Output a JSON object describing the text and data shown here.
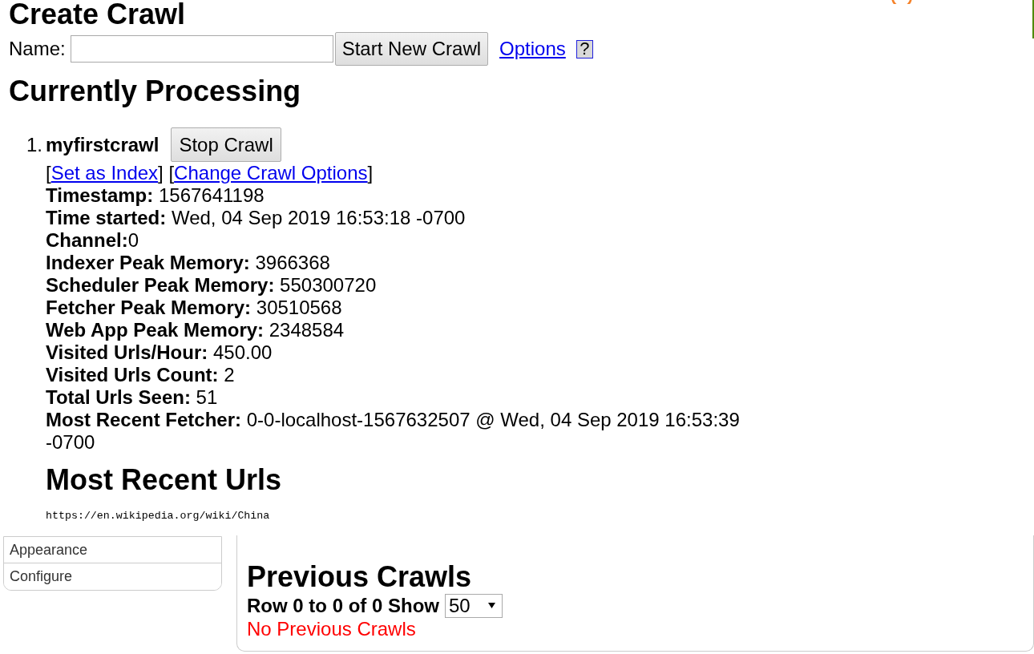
{
  "create_crawl": {
    "heading": "Create Crawl",
    "name_label": "Name:",
    "start_button": "Start New Crawl",
    "options_link": "Options",
    "help_button": "?"
  },
  "currently_processing": {
    "heading": "Currently Processing",
    "crawls": [
      {
        "number": "1.",
        "name": "myfirstcrawl",
        "stop_button": "Stop Crawl",
        "action_links": [
          {
            "before": "[",
            "text": "Set as Index",
            "after": "]"
          },
          {
            "before": "[",
            "text": "Change Crawl Options",
            "after": "]"
          }
        ],
        "stats": [
          "**Timestamp:** 1567641198",
          "**Time started:** Wed, 04 Sep 2019 16:53:18 -0700",
          "**Channel:**0",
          "**Indexer Peak Memory:** 3966368",
          "**Scheduler Peak Memory:** 550300720",
          "**Fetcher Peak Memory:** 30510568",
          "**Web App Peak Memory:** 2348584",
          "**Visited Urls/Hour:** 450.00",
          "**Visited Urls Count:** 2",
          "**Total Urls Seen:** 51",
          "**Most Recent Fetcher:** 0-0-localhost-1567632507 @ Wed, 04 Sep 2019 16:53:39 -0700"
        ],
        "recent_urls_heading": "Most Recent Urls",
        "recent_urls": [
          "https://en.wikipedia.org/wiki/China"
        ]
      }
    ]
  },
  "sidebar": {
    "items": [
      {
        "label": "Appearance",
        "selected": false
      },
      {
        "label": "Configure",
        "selected": false
      }
    ]
  },
  "previous_crawls": {
    "heading": "Previous Crawls",
    "row_info": "Row 0 to 0 of 0 Show",
    "page_size": "50",
    "empty_message": "No Previous Crawls"
  }
}
